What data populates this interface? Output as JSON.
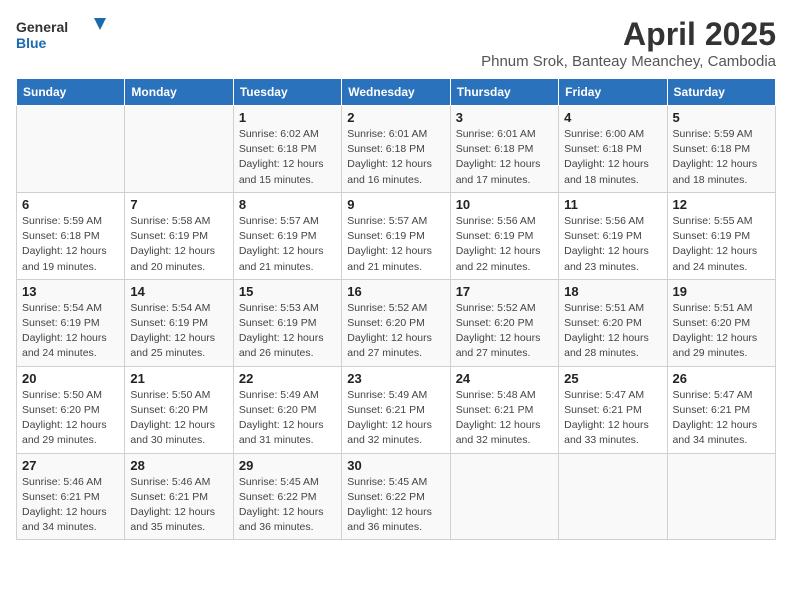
{
  "header": {
    "logo_general": "General",
    "logo_blue": "Blue",
    "month_year": "April 2025",
    "location": "Phnum Srok, Banteay Meanchey, Cambodia"
  },
  "weekdays": [
    "Sunday",
    "Monday",
    "Tuesday",
    "Wednesday",
    "Thursday",
    "Friday",
    "Saturday"
  ],
  "weeks": [
    [
      {
        "day": "",
        "info": ""
      },
      {
        "day": "",
        "info": ""
      },
      {
        "day": "1",
        "info": "Sunrise: 6:02 AM\nSunset: 6:18 PM\nDaylight: 12 hours and 15 minutes."
      },
      {
        "day": "2",
        "info": "Sunrise: 6:01 AM\nSunset: 6:18 PM\nDaylight: 12 hours and 16 minutes."
      },
      {
        "day": "3",
        "info": "Sunrise: 6:01 AM\nSunset: 6:18 PM\nDaylight: 12 hours and 17 minutes."
      },
      {
        "day": "4",
        "info": "Sunrise: 6:00 AM\nSunset: 6:18 PM\nDaylight: 12 hours and 18 minutes."
      },
      {
        "day": "5",
        "info": "Sunrise: 5:59 AM\nSunset: 6:18 PM\nDaylight: 12 hours and 18 minutes."
      }
    ],
    [
      {
        "day": "6",
        "info": "Sunrise: 5:59 AM\nSunset: 6:18 PM\nDaylight: 12 hours and 19 minutes."
      },
      {
        "day": "7",
        "info": "Sunrise: 5:58 AM\nSunset: 6:19 PM\nDaylight: 12 hours and 20 minutes."
      },
      {
        "day": "8",
        "info": "Sunrise: 5:57 AM\nSunset: 6:19 PM\nDaylight: 12 hours and 21 minutes."
      },
      {
        "day": "9",
        "info": "Sunrise: 5:57 AM\nSunset: 6:19 PM\nDaylight: 12 hours and 21 minutes."
      },
      {
        "day": "10",
        "info": "Sunrise: 5:56 AM\nSunset: 6:19 PM\nDaylight: 12 hours and 22 minutes."
      },
      {
        "day": "11",
        "info": "Sunrise: 5:56 AM\nSunset: 6:19 PM\nDaylight: 12 hours and 23 minutes."
      },
      {
        "day": "12",
        "info": "Sunrise: 5:55 AM\nSunset: 6:19 PM\nDaylight: 12 hours and 24 minutes."
      }
    ],
    [
      {
        "day": "13",
        "info": "Sunrise: 5:54 AM\nSunset: 6:19 PM\nDaylight: 12 hours and 24 minutes."
      },
      {
        "day": "14",
        "info": "Sunrise: 5:54 AM\nSunset: 6:19 PM\nDaylight: 12 hours and 25 minutes."
      },
      {
        "day": "15",
        "info": "Sunrise: 5:53 AM\nSunset: 6:19 PM\nDaylight: 12 hours and 26 minutes."
      },
      {
        "day": "16",
        "info": "Sunrise: 5:52 AM\nSunset: 6:20 PM\nDaylight: 12 hours and 27 minutes."
      },
      {
        "day": "17",
        "info": "Sunrise: 5:52 AM\nSunset: 6:20 PM\nDaylight: 12 hours and 27 minutes."
      },
      {
        "day": "18",
        "info": "Sunrise: 5:51 AM\nSunset: 6:20 PM\nDaylight: 12 hours and 28 minutes."
      },
      {
        "day": "19",
        "info": "Sunrise: 5:51 AM\nSunset: 6:20 PM\nDaylight: 12 hours and 29 minutes."
      }
    ],
    [
      {
        "day": "20",
        "info": "Sunrise: 5:50 AM\nSunset: 6:20 PM\nDaylight: 12 hours and 29 minutes."
      },
      {
        "day": "21",
        "info": "Sunrise: 5:50 AM\nSunset: 6:20 PM\nDaylight: 12 hours and 30 minutes."
      },
      {
        "day": "22",
        "info": "Sunrise: 5:49 AM\nSunset: 6:20 PM\nDaylight: 12 hours and 31 minutes."
      },
      {
        "day": "23",
        "info": "Sunrise: 5:49 AM\nSunset: 6:21 PM\nDaylight: 12 hours and 32 minutes."
      },
      {
        "day": "24",
        "info": "Sunrise: 5:48 AM\nSunset: 6:21 PM\nDaylight: 12 hours and 32 minutes."
      },
      {
        "day": "25",
        "info": "Sunrise: 5:47 AM\nSunset: 6:21 PM\nDaylight: 12 hours and 33 minutes."
      },
      {
        "day": "26",
        "info": "Sunrise: 5:47 AM\nSunset: 6:21 PM\nDaylight: 12 hours and 34 minutes."
      }
    ],
    [
      {
        "day": "27",
        "info": "Sunrise: 5:46 AM\nSunset: 6:21 PM\nDaylight: 12 hours and 34 minutes."
      },
      {
        "day": "28",
        "info": "Sunrise: 5:46 AM\nSunset: 6:21 PM\nDaylight: 12 hours and 35 minutes."
      },
      {
        "day": "29",
        "info": "Sunrise: 5:45 AM\nSunset: 6:22 PM\nDaylight: 12 hours and 36 minutes."
      },
      {
        "day": "30",
        "info": "Sunrise: 5:45 AM\nSunset: 6:22 PM\nDaylight: 12 hours and 36 minutes."
      },
      {
        "day": "",
        "info": ""
      },
      {
        "day": "",
        "info": ""
      },
      {
        "day": "",
        "info": ""
      }
    ]
  ]
}
